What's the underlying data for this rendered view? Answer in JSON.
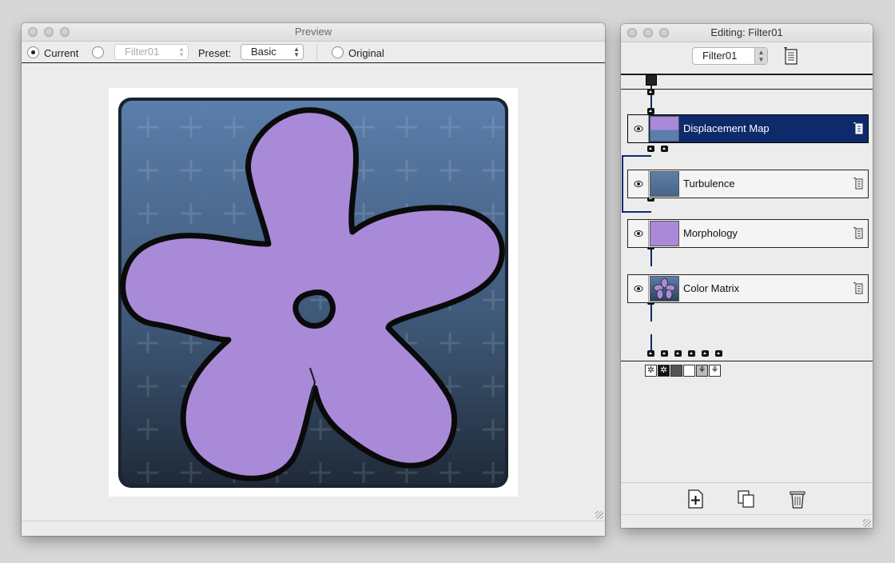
{
  "preview": {
    "title": "Preview",
    "toolbar": {
      "current_label": "Current",
      "filter_select_value": "Filter01",
      "preset_label": "Preset:",
      "preset_value": "Basic",
      "original_label": "Original"
    },
    "colors": {
      "card_top": "#5b7eab",
      "card_bottom": "#1f2a38",
      "petal": "#a98ad8",
      "outline": "#0a0a0a"
    }
  },
  "editing": {
    "title": "Editing: Filter01",
    "filter_select_value": "Filter01",
    "nodes": [
      {
        "label": "Displacement Map",
        "selected": true
      },
      {
        "label": "Turbulence",
        "selected": false
      },
      {
        "label": "Morphology",
        "selected": false
      },
      {
        "label": "Color Matrix",
        "selected": false
      }
    ],
    "selection_color": "#0d2a6b",
    "bottom_buttons": [
      "add-filter-icon",
      "duplicate-icon",
      "trash-icon"
    ]
  }
}
